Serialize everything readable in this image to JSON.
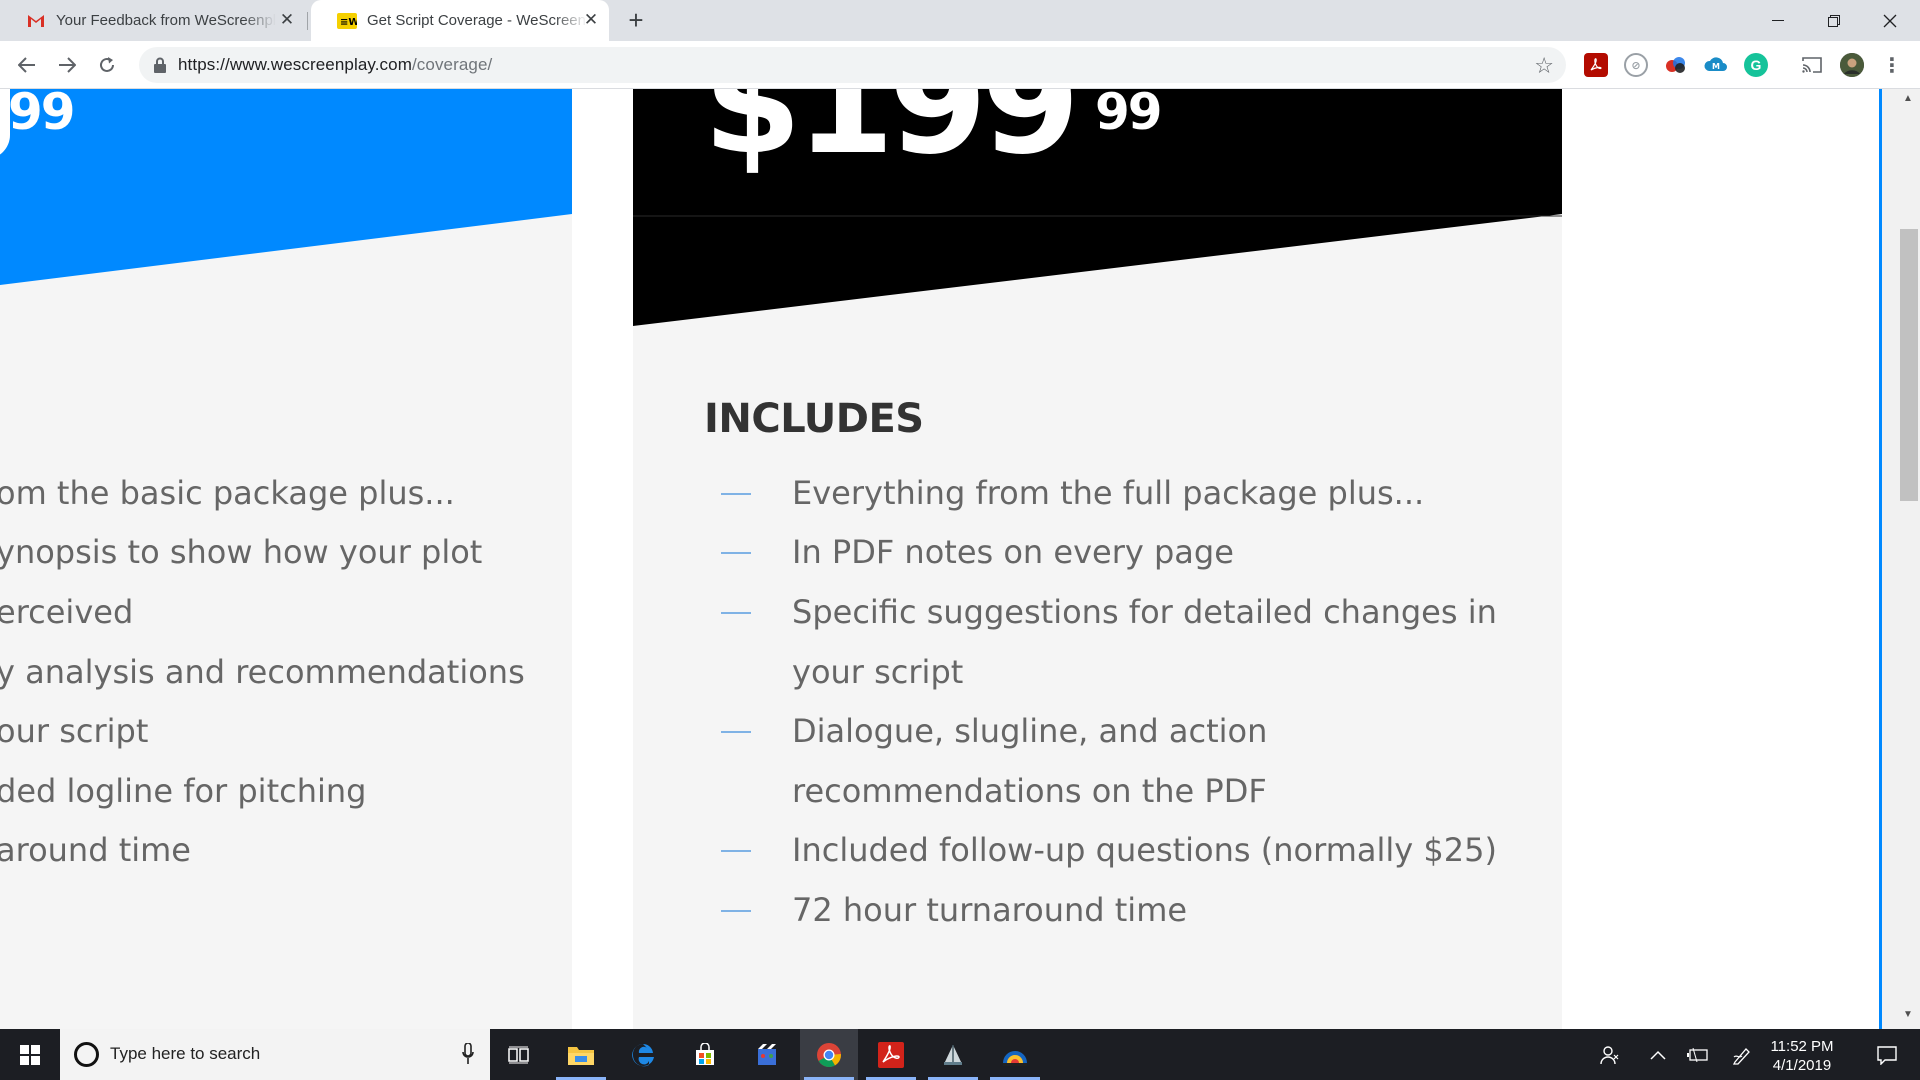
{
  "browser": {
    "tabs": [
      {
        "title": "Your Feedback from WeScreenplay",
        "favicon": "gmail-icon",
        "active": false
      },
      {
        "title": "Get Script Coverage - WeScreenplay",
        "favicon": "wescreenplay-icon",
        "active": true
      }
    ],
    "new_tab": "+",
    "url_host": "https://www.wescreenplay.com",
    "url_path": "/coverage/",
    "window_controls": {
      "minimize": "—",
      "restore": "❐",
      "close": "✕"
    }
  },
  "page": {
    "left_card": {
      "price_cents": "99",
      "features": [
        "om the basic package plus...",
        "ynopsis to show how your plot",
        "erceived",
        "y analysis and recommendations",
        "our script",
        "ded logline for pitching",
        "around time"
      ]
    },
    "right_card": {
      "price_dollars": "$199",
      "price_cents": "99",
      "includes_title": "INCLUDES",
      "features": [
        "Everything from the full package plus...",
        "In PDF notes on every page",
        "Specific suggestions for detailed changes in",
        "your script",
        "Dialogue, slugline, and action",
        "recommendations on the PDF",
        "Included follow-up questions (normally $25)",
        "72 hour turnaround time"
      ]
    },
    "colors": {
      "accent_blue": "#0089ff",
      "dark_head": "#000000",
      "card_bg": "#f5f5f5",
      "text": "#666666",
      "dash": "#7fb2e5"
    }
  },
  "taskbar": {
    "search_placeholder": "Type here to search",
    "time": "11:52 PM",
    "date": "4/1/2019"
  }
}
